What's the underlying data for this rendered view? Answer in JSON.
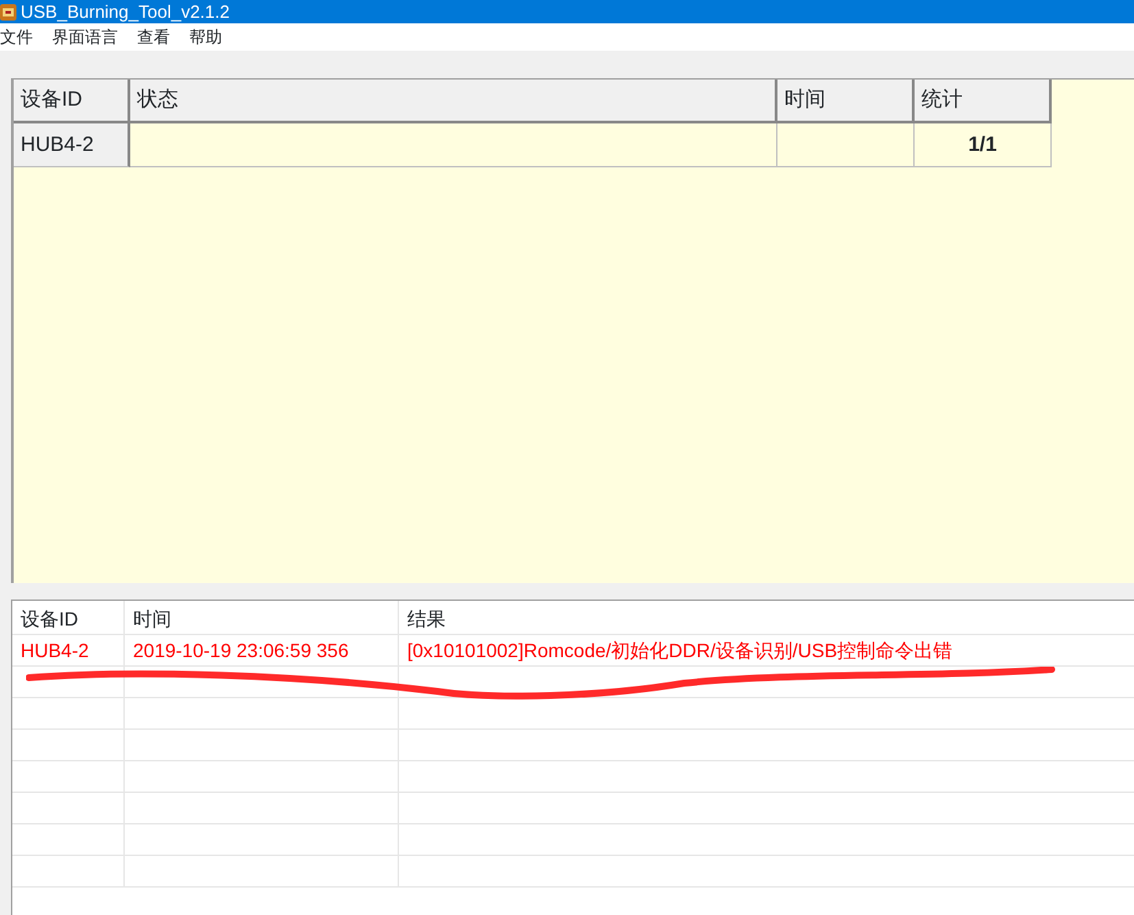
{
  "window": {
    "title": "USB_Burning_Tool_v2.1.2"
  },
  "menu": [
    "文件",
    "界面语言",
    "查看",
    "帮助"
  ],
  "device_table": {
    "columns": [
      "设备ID",
      "状态",
      "时间",
      "统计"
    ],
    "rows": [
      {
        "device_id": "HUB4-2",
        "count": "1/1"
      }
    ]
  },
  "log_table": {
    "columns": [
      "设备ID",
      "时间",
      "结果"
    ],
    "rows": [
      {
        "device_id": "HUB4-2",
        "time": "2019-10-19 23:06:59 356",
        "result": "[0x10101002]Romcode/初始化DDR/设备识别/USB控制命令出错",
        "error": true
      }
    ]
  }
}
